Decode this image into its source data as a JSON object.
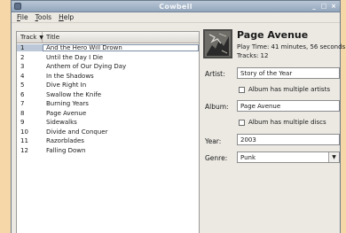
{
  "window": {
    "title": "Cowbell",
    "minimize": "_",
    "maximize": "□",
    "close": "×"
  },
  "menu": [
    {
      "label": "File",
      "mnemonic": "F",
      "rest": "ile"
    },
    {
      "label": "Tools",
      "mnemonic": "T",
      "rest": "ools"
    },
    {
      "label": "Help",
      "mnemonic": "H",
      "rest": "elp"
    }
  ],
  "tracklist": {
    "columns": {
      "track": "Track",
      "title": "Title"
    },
    "sort_icon": "chevron-down-icon",
    "selected_index": 0,
    "rows": [
      {
        "track": "1",
        "title": "And the Hero Will Drown"
      },
      {
        "track": "2",
        "title": "Until the Day I Die"
      },
      {
        "track": "3",
        "title": "Anthem of Our Dying Day"
      },
      {
        "track": "4",
        "title": "In the Shadows"
      },
      {
        "track": "5",
        "title": "Dive Right In"
      },
      {
        "track": "6",
        "title": "Swallow the Knife"
      },
      {
        "track": "7",
        "title": "Burning Years"
      },
      {
        "track": "8",
        "title": "Page Avenue"
      },
      {
        "track": "9",
        "title": "Sidewalks"
      },
      {
        "track": "10",
        "title": "Divide and Conquer"
      },
      {
        "track": "11",
        "title": "Razorblades"
      },
      {
        "track": "12",
        "title": "Falling Down"
      }
    ]
  },
  "details": {
    "album_title": "Page Avenue",
    "play_time": "Play Time: 41 minutes, 56 seconds",
    "tracks": "Tracks: 12",
    "artist_label": "Artist:",
    "artist_value": "Story of the Year",
    "multi_artists_label": "Album has multiple artists",
    "album_label": "Album:",
    "album_value": "Page Avenue",
    "multi_discs_label": "Album has multiple discs",
    "year_label": "Year:",
    "year_value": "2003",
    "genre_label": "Genre:",
    "genre_value": "Punk"
  },
  "colors": {
    "desktop": "#f6d8a8",
    "titlebar": "#93a6bc",
    "selection": "#bcc8d7"
  }
}
